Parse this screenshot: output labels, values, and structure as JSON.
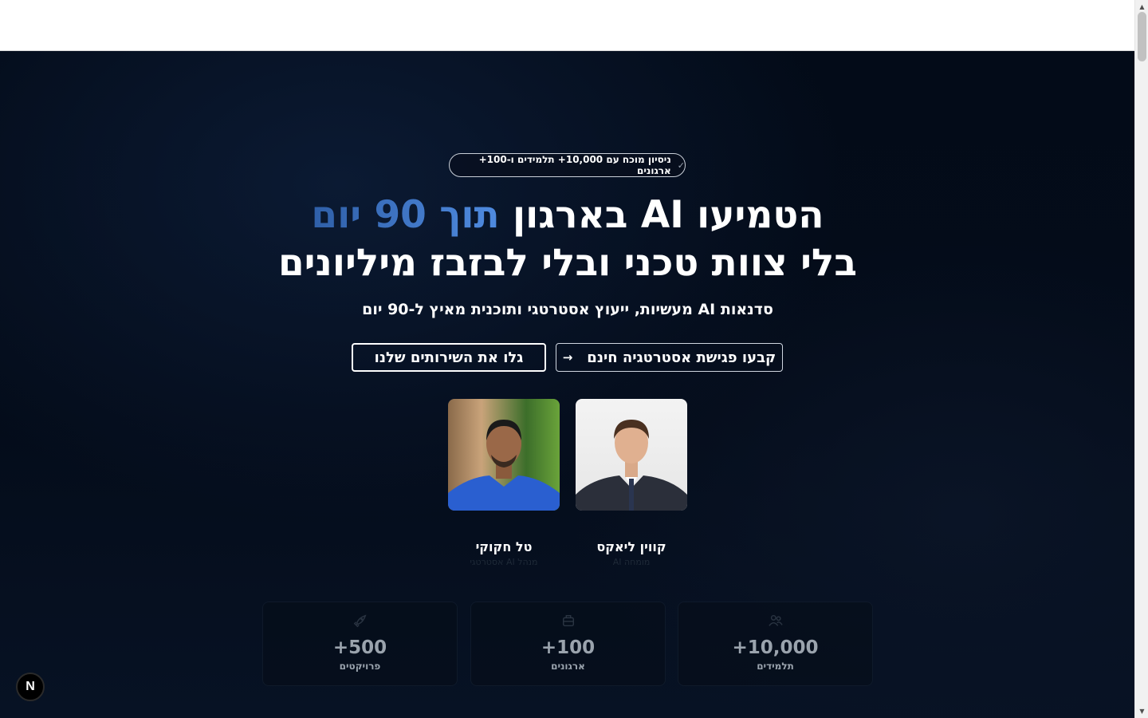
{
  "hero": {
    "badge_text": "ניסיון מוכח עם 10,000+ תלמידים ו-100+ ארגונים",
    "title_line1_start": "הטמיעו AI בארגון ",
    "title_line1_accent": "תוך 90 יום",
    "title_line2": "בלי צוות טכני ובלי לבזבז מיליונים",
    "subtitle": "סדנאות AI מעשיות, ייעוץ אסטרטגי ותוכנית מאיץ ל-90 יום",
    "primary_button": "קבעו פגישת אסטרטגיה חינם",
    "secondary_button": "גלו את השירותים שלנו"
  },
  "people": [
    {
      "name": "קווין ליאקס",
      "role": "מומחה AI"
    },
    {
      "name": "טל חקוקי",
      "role": "מנהל AI אסטרטגי"
    }
  ],
  "stats": [
    {
      "value": "+10,000",
      "label": "תלמידים",
      "icon": "students-icon"
    },
    {
      "value": "+100",
      "label": "ארגונים",
      "icon": "building-icon"
    },
    {
      "value": "+500",
      "label": "פרויקטים",
      "icon": "rocket-icon"
    }
  ],
  "dev_badge": {
    "letter": "N"
  },
  "colors": {
    "background": "#040c1a",
    "accent": "#4f8be0",
    "text": "#ffffff"
  }
}
